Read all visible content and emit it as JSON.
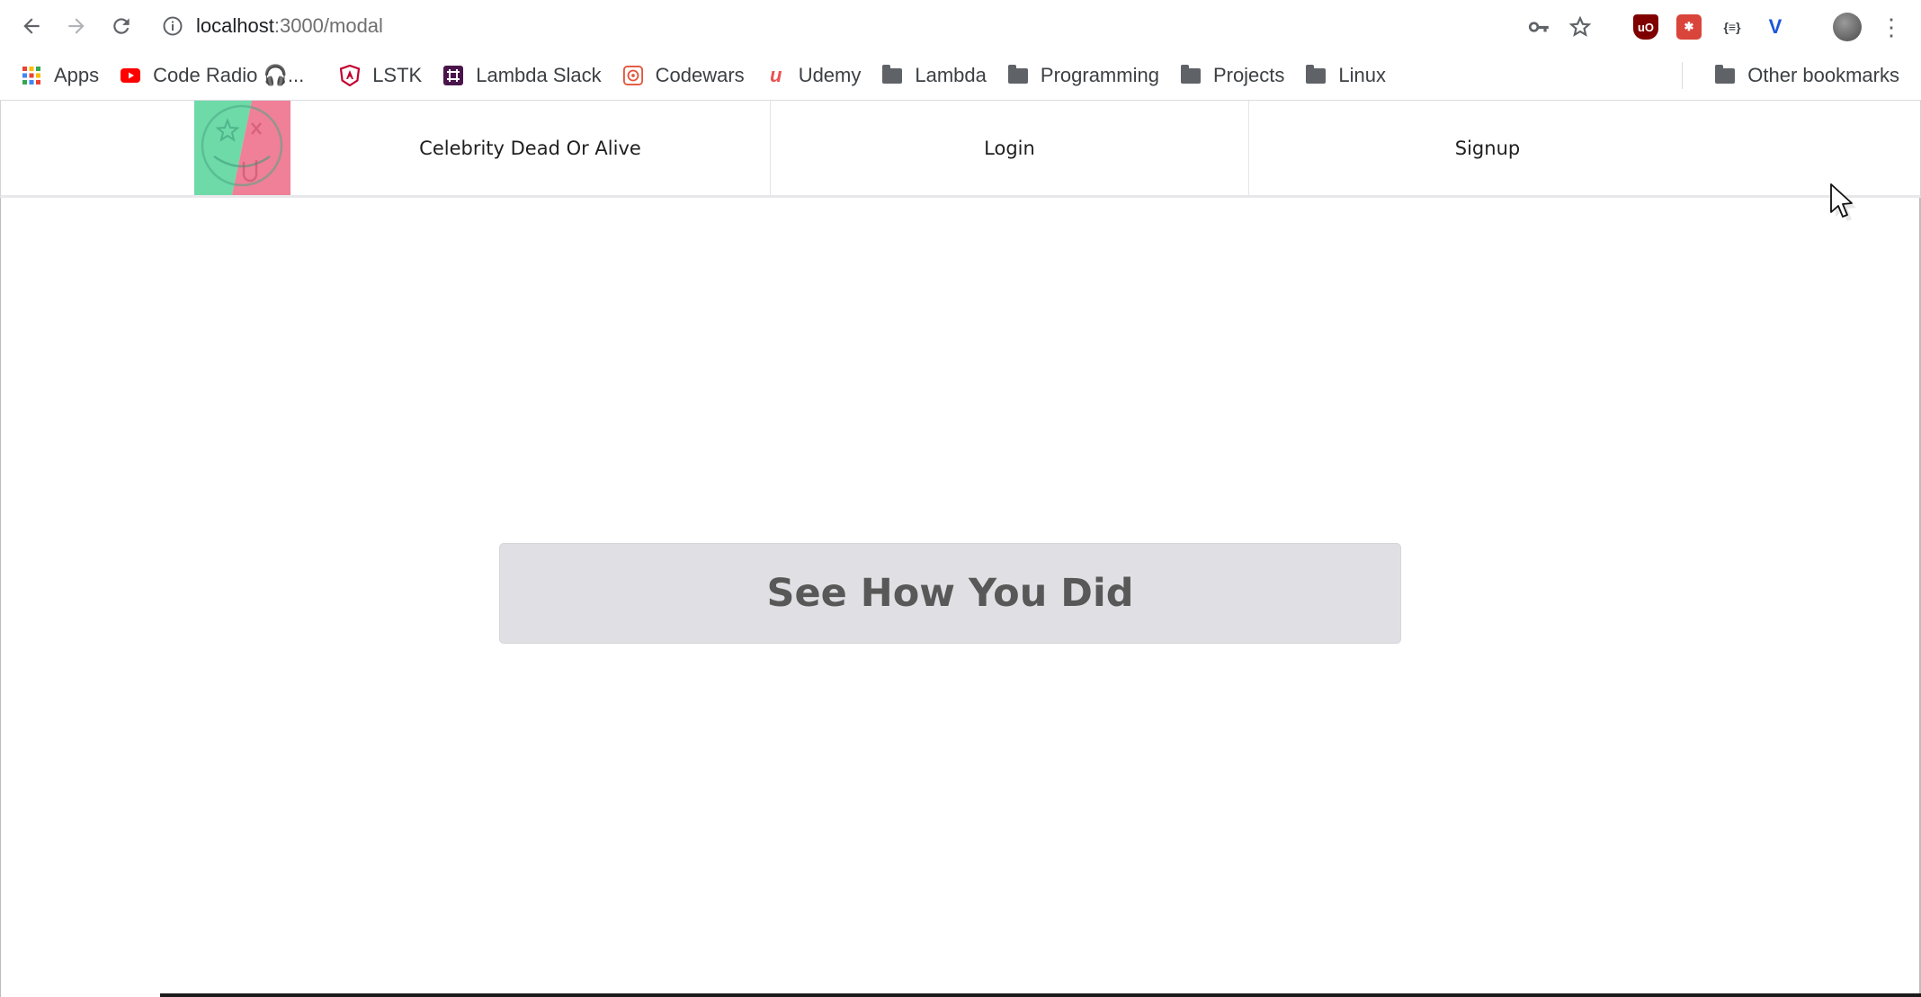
{
  "browser": {
    "url_host": "localhost",
    "url_path": ":3000/modal",
    "bookmarks": [
      {
        "label": "Apps",
        "icon": "apps-grid-icon"
      },
      {
        "label": "Code Radio 🎧...",
        "icon": "youtube-icon"
      },
      {
        "label": "LSTK",
        "icon": "angular-shield-icon"
      },
      {
        "label": "Lambda Slack",
        "icon": "slack-icon"
      },
      {
        "label": "Codewars",
        "icon": "codewars-icon"
      },
      {
        "label": "Udemy",
        "icon": "udemy-icon"
      },
      {
        "label": "Lambda",
        "icon": "folder-icon"
      },
      {
        "label": "Programming",
        "icon": "folder-icon"
      },
      {
        "label": "Projects",
        "icon": "folder-icon"
      },
      {
        "label": "Linux",
        "icon": "folder-icon"
      }
    ],
    "other_bookmarks": "Other bookmarks"
  },
  "site": {
    "brand": "Celebrity Dead Or Alive",
    "login": "Login",
    "signup": "Signup"
  },
  "main": {
    "cta_label": "See How You Did"
  },
  "colors": {
    "logo_green": "#6ddaa8",
    "logo_pink": "#f07f98",
    "cta_bg": "#e0e0e4",
    "cta_text": "#585858"
  }
}
